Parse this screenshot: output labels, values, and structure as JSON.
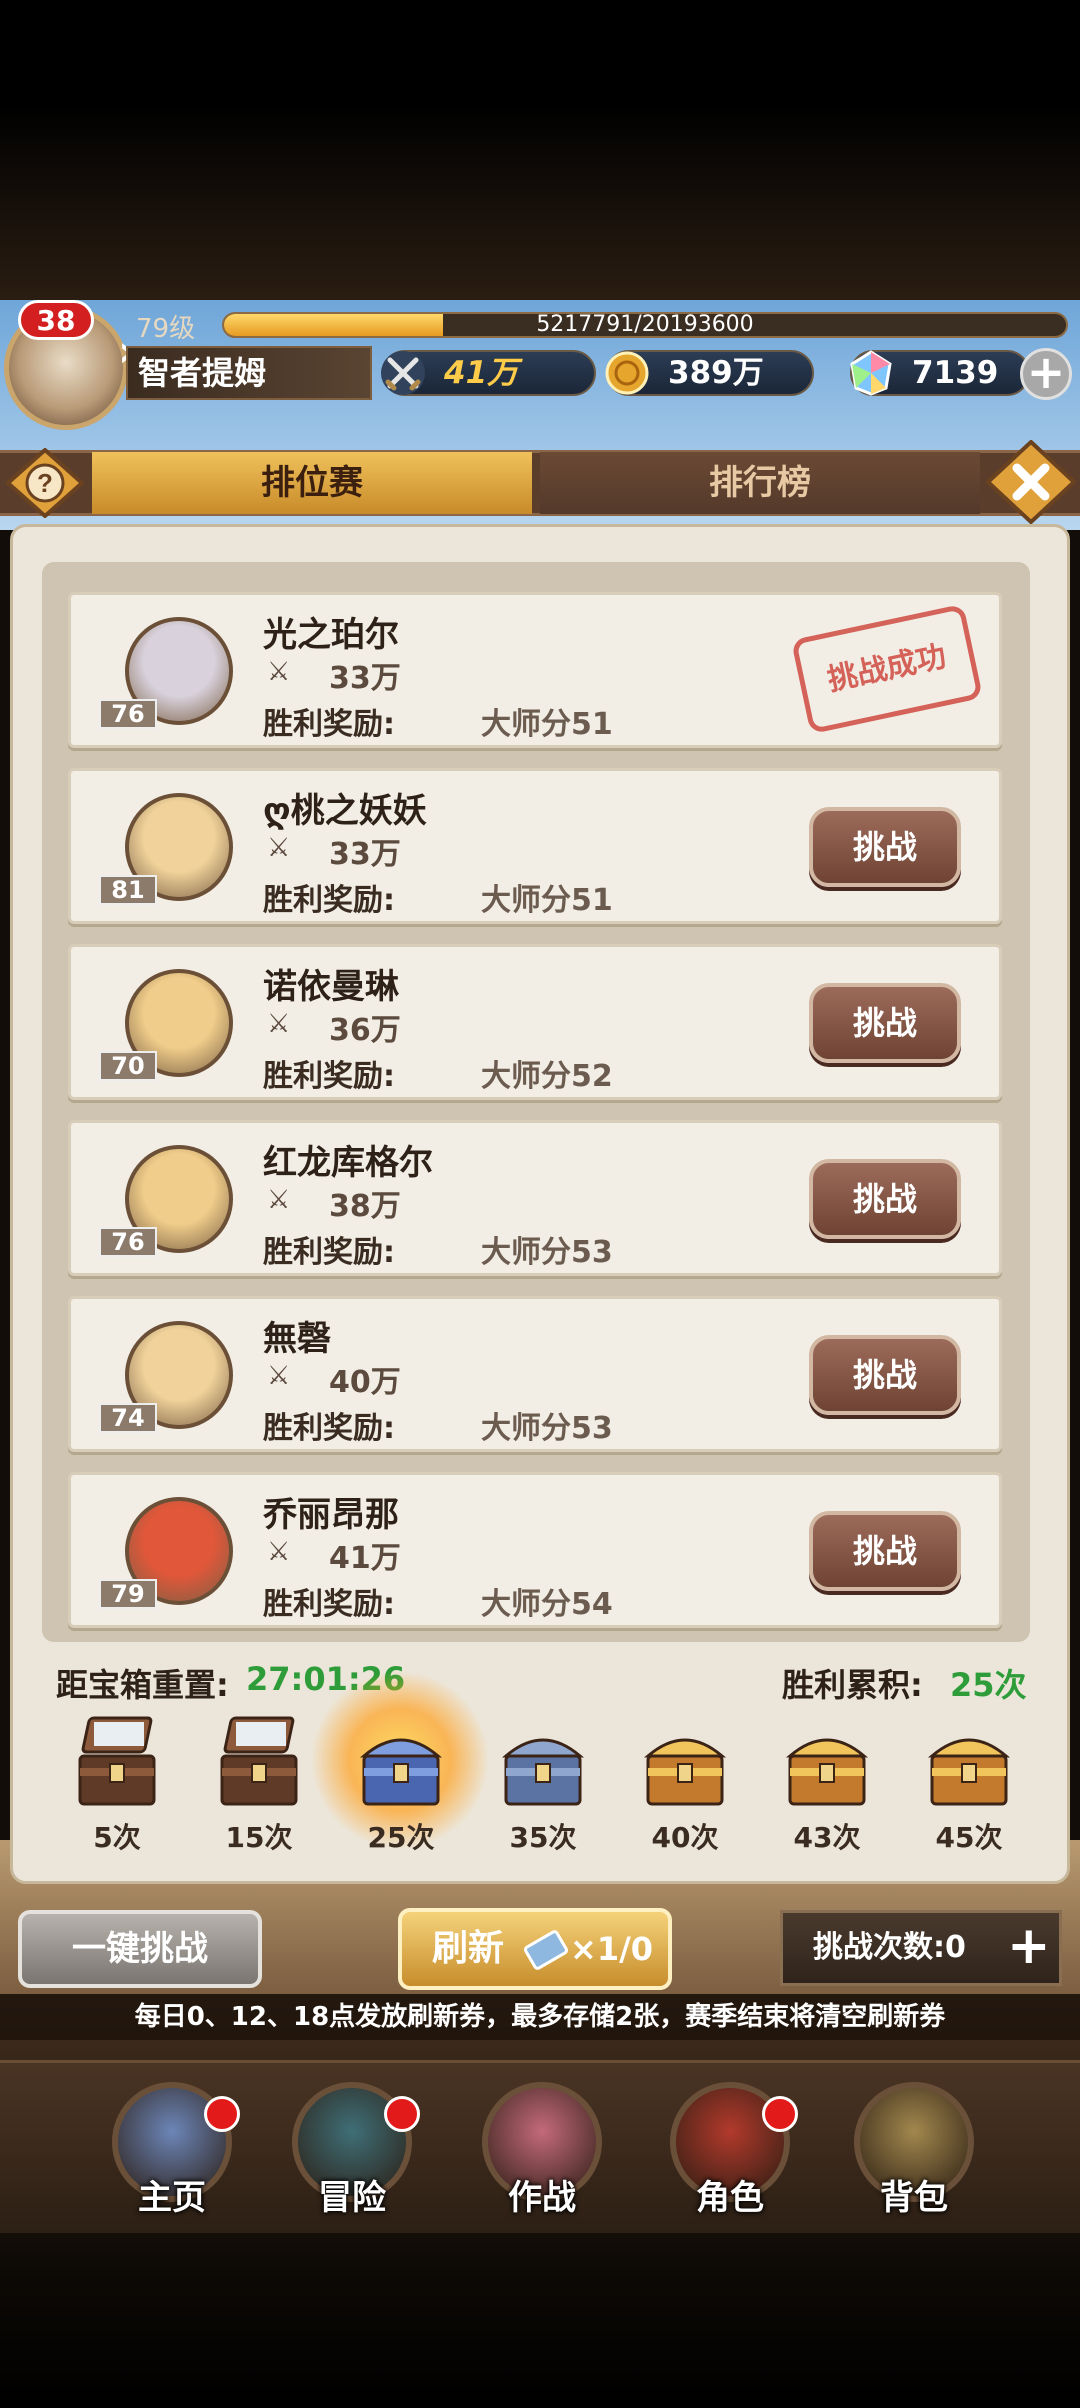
{
  "player": {
    "level_badge": "38",
    "level_text": "79级",
    "exp_text": "5217791/20193600",
    "exp_progress": 0.26,
    "name": "智者提姆",
    "power": "41万",
    "gold": "389万",
    "gems": "7139"
  },
  "tabs": {
    "ranking_match": "排位赛",
    "leaderboard": "排行榜"
  },
  "opponents": [
    {
      "name": "光之珀尔",
      "level": "76",
      "power": "33万",
      "reward_label": "胜利奖励:",
      "reward": "大师分51",
      "status": "挑战成功",
      "portrait_color": "#d9d2dd"
    },
    {
      "name": "ღ桃之妖妖",
      "level": "81",
      "power": "33万",
      "reward_label": "胜利奖励:",
      "reward": "大师分51",
      "button": "挑战",
      "portrait_color": "#f0d29a"
    },
    {
      "name": "诺依曼琳",
      "level": "70",
      "power": "36万",
      "reward_label": "胜利奖励:",
      "reward": "大师分52",
      "button": "挑战",
      "portrait_color": "#f0cd8a"
    },
    {
      "name": "红龙库格尔",
      "level": "76",
      "power": "38万",
      "reward_label": "胜利奖励:",
      "reward": "大师分53",
      "button": "挑战",
      "portrait_color": "#f0cd8a"
    },
    {
      "name": "無磬",
      "level": "74",
      "power": "40万",
      "reward_label": "胜利奖励:",
      "reward": "大师分53",
      "button": "挑战",
      "portrait_color": "#f0d29a"
    },
    {
      "name": "乔丽昂那",
      "level": "79",
      "power": "41万",
      "reward_label": "胜利奖励:",
      "reward": "大师分54",
      "button": "挑战",
      "portrait_color": "#e0573a"
    }
  ],
  "chest_section": {
    "reset_label": "距宝箱重置:",
    "reset_time": "27:01:26",
    "wins_label": "胜利累积:",
    "wins_value": "25次",
    "chests": [
      {
        "count": "5次",
        "state": "opened"
      },
      {
        "count": "15次",
        "state": "opened"
      },
      {
        "count": "25次",
        "state": "glowing"
      },
      {
        "count": "35次",
        "state": "silver"
      },
      {
        "count": "40次",
        "state": "gold"
      },
      {
        "count": "43次",
        "state": "gold"
      },
      {
        "count": "45次",
        "state": "gold"
      }
    ]
  },
  "controls": {
    "one_click": "一键挑战",
    "refresh": "刷新",
    "refresh_count": "×1/0",
    "challenge_count": "挑战次数:0",
    "plus": "+"
  },
  "notice": "每日0、12、18点发放刷新券，最多存储2张，赛季结束将清空刷新券",
  "nav": [
    {
      "label": "主页",
      "badge": true
    },
    {
      "label": "冒险",
      "badge": true
    },
    {
      "label": "作战",
      "badge": false
    },
    {
      "label": "角色",
      "badge": true
    },
    {
      "label": "背包",
      "badge": false
    }
  ],
  "colors": {
    "accent_gold": "#e7a733",
    "win_green": "#2e9d39",
    "stamp_red": "#cf4a41",
    "badge_red": "#e21a1a"
  }
}
